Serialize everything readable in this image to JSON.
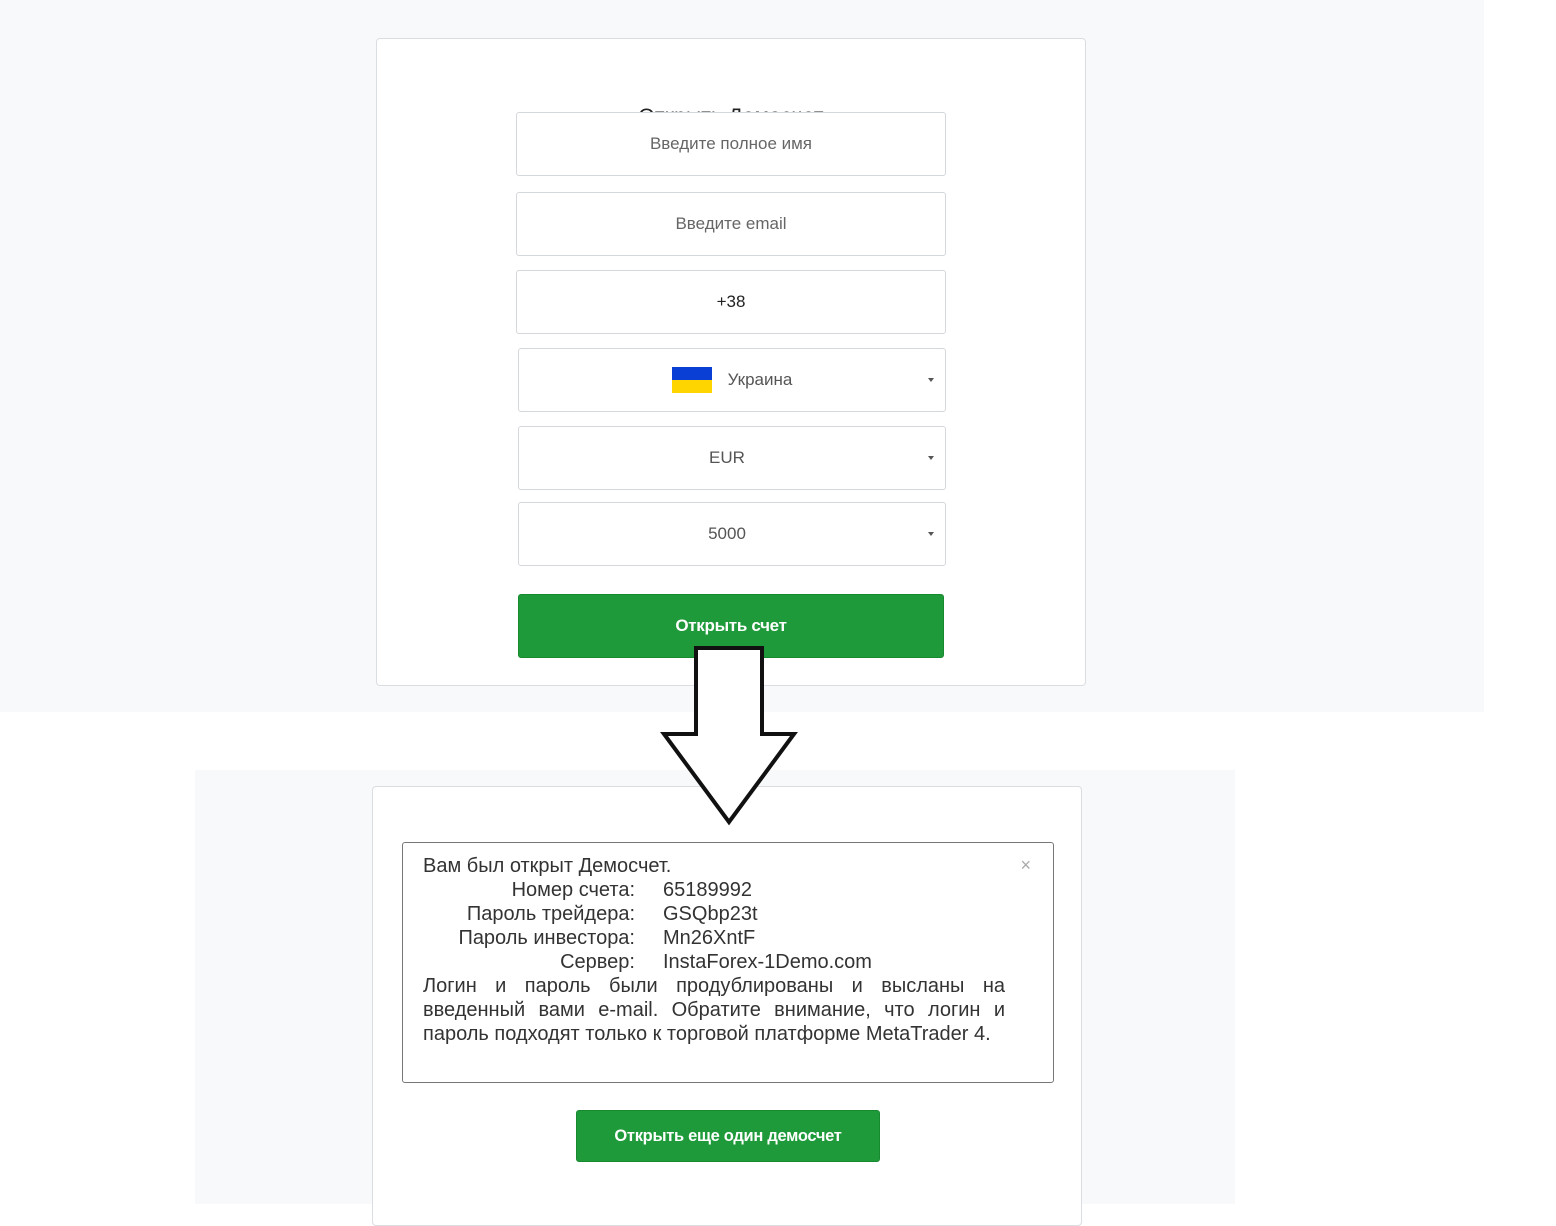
{
  "form": {
    "title": "Открыть Демосчет",
    "name_placeholder": "Введите полное имя",
    "email_placeholder": "Введите email",
    "phone_value": "+38",
    "country": {
      "label": "Украина",
      "flag_icon": "ukraine-flag-icon",
      "flag_colors": [
        "#0a3fd6",
        "#ffd500"
      ]
    },
    "currency": "EUR",
    "deposit": "5000",
    "submit_label": "Открыть счет"
  },
  "result": {
    "heading": "Вам был открыт Демосчет.",
    "rows": [
      {
        "label": "Номер счета:",
        "value": "65189992"
      },
      {
        "label": "Пароль трейдера:",
        "value": "GSQbp23t"
      },
      {
        "label": "Пароль инвестора:",
        "value": "Mn26XntF"
      },
      {
        "label": "Сервер:",
        "value": "InstaForex-1Demo.com"
      }
    ],
    "note": "Логин и пароль были продублированы и высланы на введенный вами e-mail. Обратите внимание, что логин и пароль подходят только к торговой платформе MetaTrader 4.",
    "close_symbol": "×",
    "again_label": "Открыть еще один демосчет"
  },
  "colors": {
    "accent_green": "#1f9a3a"
  }
}
